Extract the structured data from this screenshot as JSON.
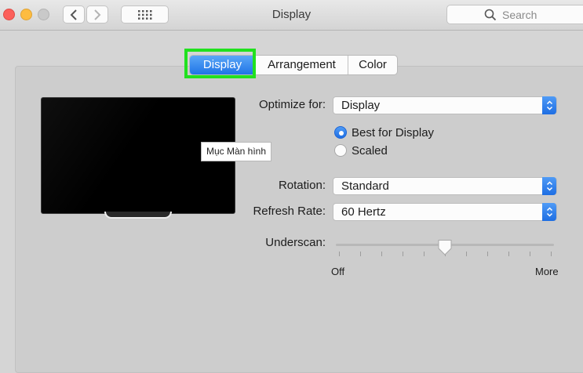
{
  "window": {
    "title": "Display"
  },
  "search": {
    "placeholder": "Search"
  },
  "tabs": [
    "Display",
    "Arrangement",
    "Color"
  ],
  "tooltip": "Mục Màn hình",
  "optimize": {
    "label": "Optimize for:",
    "value": "Display"
  },
  "resolution": {
    "options": [
      "Best for Display",
      "Scaled"
    ],
    "selected": "Best for Display"
  },
  "rotation": {
    "label": "Rotation:",
    "value": "Standard"
  },
  "refresh": {
    "label": "Refresh Rate:",
    "value": "60 Hertz"
  },
  "underscan": {
    "label": "Underscan:",
    "min_label": "Off",
    "max_label": "More",
    "value_fraction": 0.5,
    "ticks": 11
  },
  "colors": {
    "accent": "#1f74e7",
    "highlight_box": "#21e11f"
  },
  "icons": [
    "close-light",
    "minimize-light",
    "zoom-light",
    "chevron-left-icon",
    "chevron-right-icon",
    "grid-icon",
    "search-icon",
    "popup-arrows-icon",
    "slider-thumb"
  ]
}
